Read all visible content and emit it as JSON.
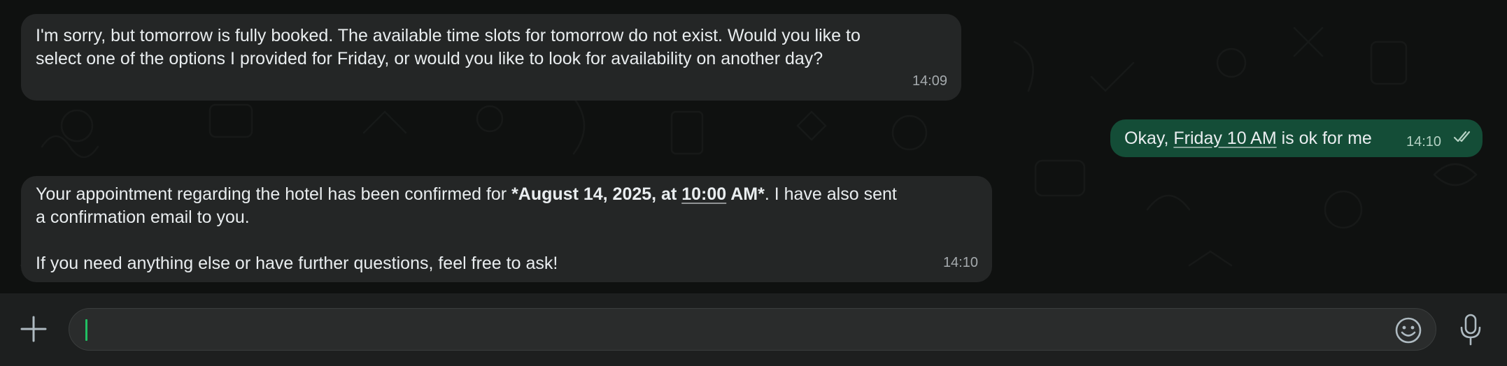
{
  "messages": [
    {
      "direction": "incoming",
      "text_line1": "I'm sorry, but tomorrow is fully booked. The available time slots for tomorrow do not exist. Would you like to",
      "text_line2": "select one of the options I provided for Friday, or would you like to look for availability on another day?",
      "time": "14:09"
    },
    {
      "direction": "outgoing",
      "text_before": "Okay, ",
      "text_link": "Friday 10 AM",
      "text_after": " is ok for me",
      "time": "14:10",
      "status": "read-double-check"
    },
    {
      "direction": "incoming",
      "line1_before": "Your appointment regarding the hotel has been confirmed for ",
      "line1_bold_a": "*August 14, 2025, at ",
      "line1_bold_link": "10:00",
      "line1_bold_b": " AM*",
      "line1_after": ". I have also sent",
      "line2": "a confirmation email to you.",
      "line3": "If you need anything else or have further questions, feel free to ask!",
      "time": "14:10"
    }
  ],
  "composer": {
    "placeholder": "",
    "value": "",
    "icons": {
      "attach": "plus-icon",
      "emoji": "emoji-icon",
      "voice": "microphone-icon"
    }
  },
  "colors": {
    "incoming_bubble": "#242626",
    "outgoing_bubble": "#144d37",
    "caret": "#21c063",
    "background": "#0f1110"
  }
}
